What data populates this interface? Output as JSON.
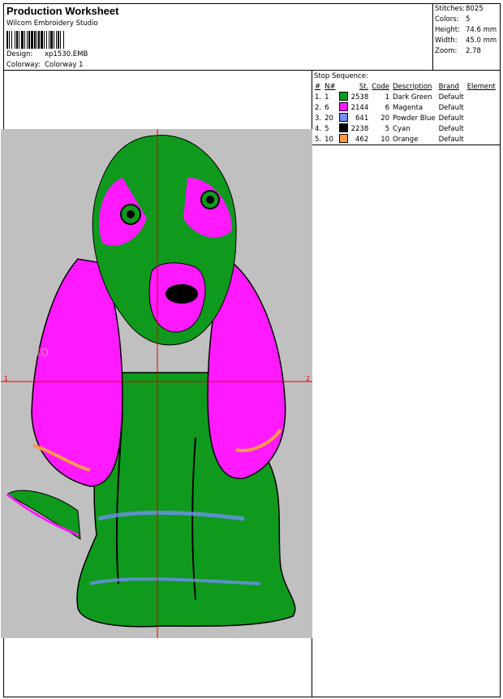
{
  "header": {
    "title": "Production Worksheet",
    "software": "Wilcom Embroidery Studio",
    "design_label": "Design:",
    "design_value": "xp1530.EMB",
    "colorway_label": "Colorway:",
    "colorway_value": "Colorway 1"
  },
  "stats": [
    {
      "label": "Stitches:",
      "value": "8025"
    },
    {
      "label": "Colors:",
      "value": "5"
    },
    {
      "label": "Height:",
      "value": "74.6 mm"
    },
    {
      "label": "Width:",
      "value": "45.0 mm"
    },
    {
      "label": "Zoom:",
      "value": "2.78"
    }
  ],
  "stop_sequence": {
    "title": "Stop Sequence:",
    "headers": [
      "#",
      "N#",
      "St.",
      "Code",
      "Description",
      "Brand",
      "Element"
    ],
    "rows": [
      {
        "idx": "1.",
        "n": "1",
        "color": "#0f9a1e",
        "st": "2538",
        "code": "1",
        "desc": "Dark Green",
        "brand": "Default"
      },
      {
        "idx": "2.",
        "n": "6",
        "color": "#ff1aff",
        "st": "2144",
        "code": "6",
        "desc": "Magenta",
        "brand": "Default"
      },
      {
        "idx": "3.",
        "n": "20",
        "color": "#6f8ff0",
        "st": "641",
        "code": "20",
        "desc": "Powder Blue",
        "brand": "Default"
      },
      {
        "idx": "4.",
        "n": "5",
        "color": "#000000",
        "st": "2238",
        "code": "5",
        "desc": "Cyan",
        "brand": "Default"
      },
      {
        "idx": "5.",
        "n": "10",
        "color": "#ff9a4a",
        "st": "462",
        "code": "10",
        "desc": "Orange",
        "brand": "Default"
      }
    ]
  },
  "canvas": {
    "axis_label_left": "1",
    "axis_label_right": "2",
    "watermark": "to",
    "background_color": "#c0c0c0",
    "crosshair_color": "#e00000"
  }
}
